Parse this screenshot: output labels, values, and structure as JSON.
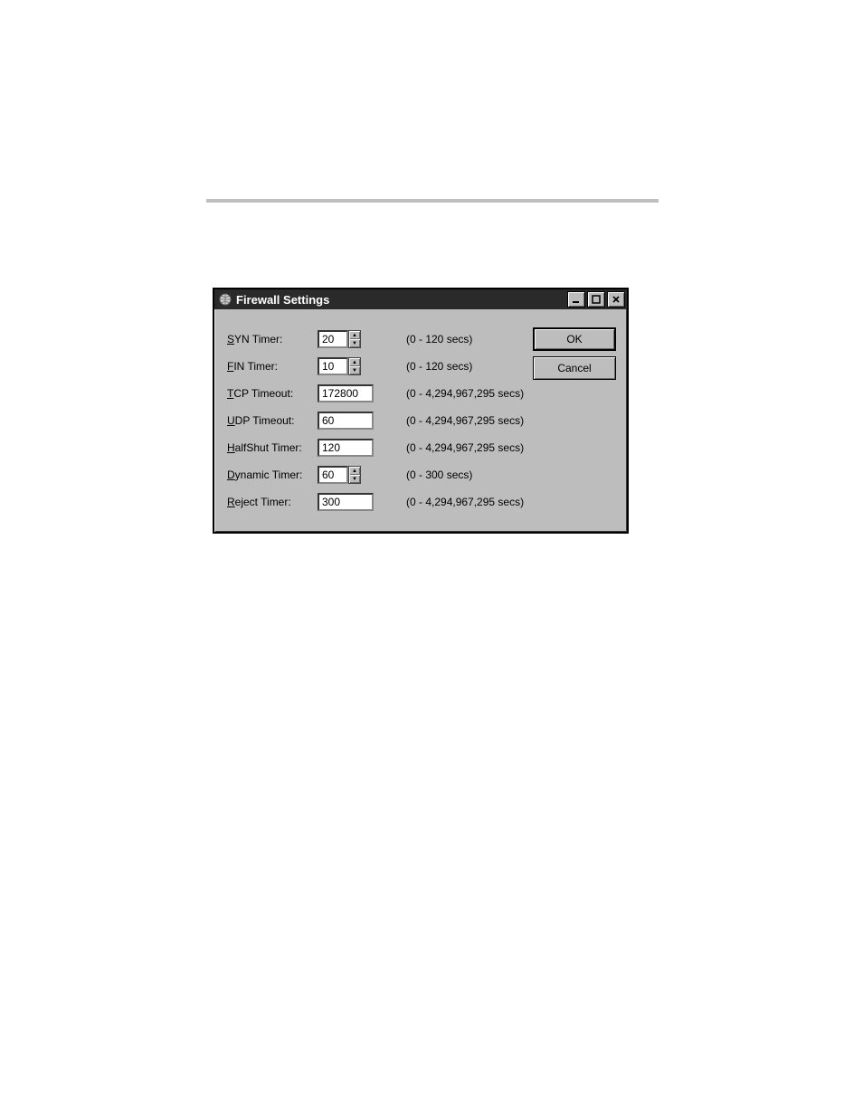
{
  "window": {
    "title": "Firewall Settings",
    "icon": "globe-icon"
  },
  "controls": {
    "minimize": "minimize",
    "maximize": "maximize",
    "close": "close"
  },
  "form": {
    "syn": {
      "label_prefix": "S",
      "label_rest": "YN Timer:",
      "value": "20",
      "hint": "(0 - 120 secs)",
      "has_spinner": true
    },
    "fin": {
      "label_prefix": "F",
      "label_rest": "IN Timer:",
      "value": "10",
      "hint": "(0 - 120 secs)",
      "has_spinner": true
    },
    "tcp": {
      "label_prefix": "T",
      "label_rest": "CP Timeout:",
      "value": "172800",
      "hint": "(0 - 4,294,967,295 secs)",
      "has_spinner": false
    },
    "udp": {
      "label_prefix": "U",
      "label_rest": "DP Timeout:",
      "value": "60",
      "hint": "(0 - 4,294,967,295 secs)",
      "has_spinner": false
    },
    "halfshut": {
      "label_prefix": "H",
      "label_rest": "alfShut Timer:",
      "value": "120",
      "hint": "(0 - 4,294,967,295 secs)",
      "has_spinner": false
    },
    "dynamic": {
      "label_prefix": "D",
      "label_rest": "ynamic Timer:",
      "value": "60",
      "hint": "(0 - 300 secs)",
      "has_spinner": true
    },
    "reject": {
      "label_prefix": "R",
      "label_rest": "eject Timer:",
      "value": "300",
      "hint": "(0 - 4,294,967,295 secs)",
      "has_spinner": false
    }
  },
  "buttons": {
    "ok": "OK",
    "cancel": "Cancel"
  }
}
